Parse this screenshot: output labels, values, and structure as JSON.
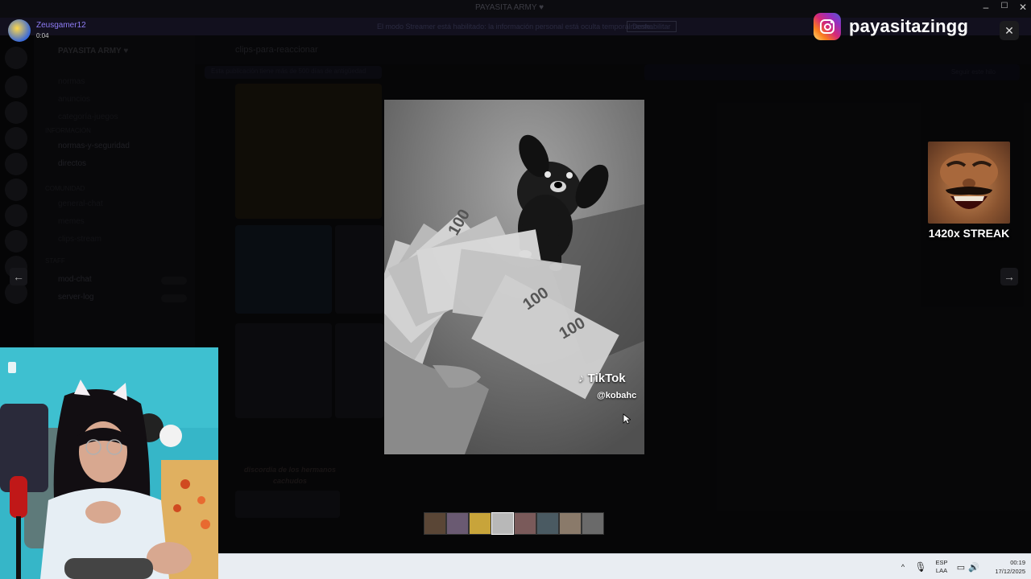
{
  "window": {
    "title": "PAYASITA ARMY ♥",
    "controls": [
      "–",
      "☐",
      "✕"
    ]
  },
  "discord_background": {
    "banner_text": "El modo Streamer está habilitado: la información personal está oculta temporalmente.",
    "banner_button": "Deshabilitar",
    "server_name": "PAYASITA ARMY ♥",
    "channel_header": "clips-para-reaccionar",
    "channels": [
      {
        "label": "normas",
        "dim": true
      },
      {
        "label": "anuncios",
        "dim": true
      },
      {
        "label": "categoría-juegos",
        "dim": true
      },
      {
        "label": "normas-y-seguridad",
        "dim": false
      },
      {
        "label": "directos",
        "dim": false
      },
      {
        "label": "general-chat",
        "dim": true
      },
      {
        "label": "memes",
        "dim": true
      },
      {
        "label": "clips-stream",
        "dim": true
      },
      {
        "label": "mod-chat",
        "dim": false
      },
      {
        "label": "server-log",
        "dim": false
      }
    ],
    "categories": [
      "INFORMACIÓN",
      "COMUNIDAD",
      "STAFF"
    ],
    "notice_left": "Esta publicación tiene más de 500 días de antigüedad",
    "notice_right": "Seguir este hilo",
    "caption": "discordia de los hermanos cachudos"
  },
  "user_chip": {
    "username": "Zeusgamer12",
    "timer": "0:04"
  },
  "media_viewer": {
    "watermark_brand": "TikTok",
    "watermark_handle": "@kobahc",
    "thumbnail_count": 8,
    "selected_thumbnail": 3
  },
  "instagram_overlay": {
    "handle": "payasitazingg"
  },
  "streak_overlay": {
    "label": "1420x STREAK"
  },
  "taskbar": {
    "lang_top": "ESP",
    "lang_bottom": "LAA",
    "time": "00:19",
    "date": "17/12/2025"
  },
  "colors": {
    "username": "#8f7df6",
    "webcam_wall": "#36b6c8",
    "taskbar": "#e9edf2"
  }
}
